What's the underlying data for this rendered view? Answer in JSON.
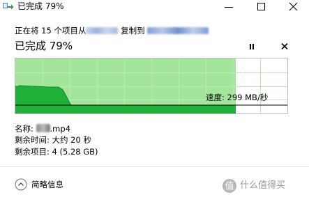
{
  "window": {
    "title": "已完成 79%",
    "icons": [
      "copy-arrow-icon",
      "minimize-icon",
      "maximize-icon",
      "close-icon"
    ]
  },
  "status": {
    "prefix": "正在将 15 个项目从",
    "middle": "复制到"
  },
  "progress": {
    "title": "已完成 79%",
    "fraction": 0.79
  },
  "graph": {
    "speed_label": "速度: 299 MB/秒",
    "colors": {
      "done": "#a4e59c",
      "fill": "#1fb03a",
      "line": "#000000",
      "grid": "#bfe8b8"
    }
  },
  "details": {
    "name_label": "名称:",
    "name_suffix": ".mp4",
    "time_remaining": "剩余时间: 大约 20 秒",
    "items_remaining": "剩余项目: 4 (5.28 GB)"
  },
  "footer": {
    "toggle_label": "简略信息",
    "toggle_icon": "chevron-up-circle-icon"
  },
  "watermark": {
    "text": "什么值得买"
  }
}
